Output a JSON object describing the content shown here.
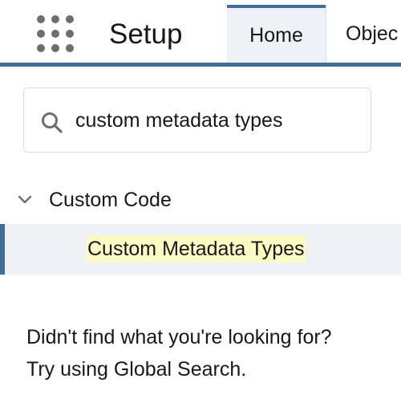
{
  "header": {
    "app_title": "Setup",
    "app_launcher_icon": "app-launcher-grid-icon",
    "tabs": [
      {
        "label": "Home",
        "active": true
      },
      {
        "label": "Objec",
        "active": false
      }
    ],
    "accent_color": "#3f6e97"
  },
  "search": {
    "icon": "search-icon",
    "value": "custom metadata types"
  },
  "tree": {
    "group_icon": "chevron-down-icon",
    "group_label": "Custom Code",
    "items": [
      {
        "label": "Custom Metadata Types",
        "selected": true,
        "highlight_color": "#fcfac5"
      }
    ]
  },
  "help": {
    "line1": "Didn't find what you're looking for?",
    "line2": "Try using Global Search."
  }
}
